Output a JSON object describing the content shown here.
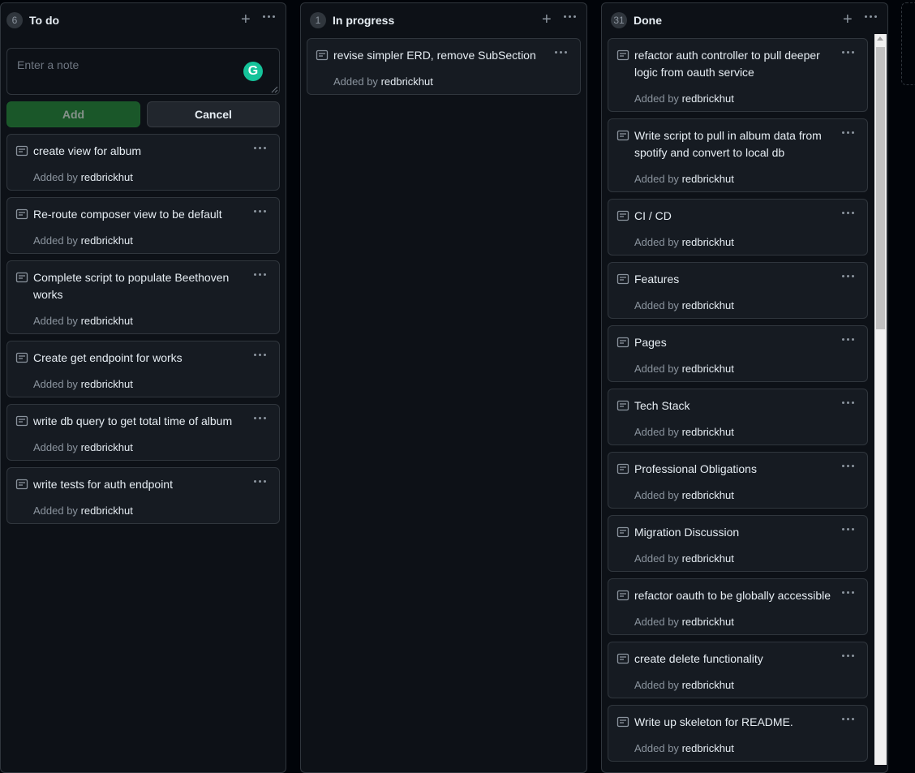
{
  "columns": [
    {
      "title": "To do",
      "count": "6",
      "note_placeholder": "Enter a note",
      "add_label": "Add",
      "cancel_label": "Cancel",
      "cards": [
        {
          "title": "create view for album",
          "added_by": "Added by",
          "author": "redbrickhut"
        },
        {
          "title": "Re-route composer view to be default",
          "added_by": "Added by",
          "author": "redbrickhut"
        },
        {
          "title": "Complete script to populate Beethoven works",
          "added_by": "Added by",
          "author": "redbrickhut"
        },
        {
          "title": "Create get endpoint for works",
          "added_by": "Added by",
          "author": "redbrickhut"
        },
        {
          "title": "write db query to get total time of album",
          "added_by": "Added by",
          "author": "redbrickhut"
        },
        {
          "title": "write tests for auth endpoint",
          "added_by": "Added by",
          "author": "redbrickhut"
        }
      ]
    },
    {
      "title": "In progress",
      "count": "1",
      "cards": [
        {
          "title": "revise simpler ERD, remove SubSection",
          "added_by": "Added by",
          "author": "redbrickhut"
        }
      ]
    },
    {
      "title": "Done",
      "count": "31",
      "cards": [
        {
          "title": "refactor auth controller to pull deeper logic from oauth service",
          "added_by": "Added by",
          "author": "redbrickhut"
        },
        {
          "title": "Write script to pull in album data from spotify and convert to local db",
          "added_by": "Added by",
          "author": "redbrickhut"
        },
        {
          "title": "CI / CD",
          "added_by": "Added by",
          "author": "redbrickhut"
        },
        {
          "title": "Features",
          "added_by": "Added by",
          "author": "redbrickhut"
        },
        {
          "title": "Pages",
          "added_by": "Added by",
          "author": "redbrickhut"
        },
        {
          "title": "Tech Stack",
          "added_by": "Added by",
          "author": "redbrickhut"
        },
        {
          "title": "Professional Obligations",
          "added_by": "Added by",
          "author": "redbrickhut"
        },
        {
          "title": "Migration Discussion",
          "added_by": "Added by",
          "author": "redbrickhut"
        },
        {
          "title": "refactor oauth to be globally accessible",
          "added_by": "Added by",
          "author": "redbrickhut"
        },
        {
          "title": "create delete functionality",
          "added_by": "Added by",
          "author": "redbrickhut"
        },
        {
          "title": "Write up skeleton for README.",
          "added_by": "Added by",
          "author": "redbrickhut"
        }
      ]
    }
  ],
  "icons": {
    "add": "plus-icon",
    "more": "kebab-horizontal-icon",
    "note": "note-icon",
    "grammarly": "grammarly-icon"
  },
  "colors": {
    "background": "#010409",
    "column": "#0d1117",
    "card": "#161b22",
    "border": "#30363d",
    "add_button": "#238636",
    "grammarly": "#15c39a"
  }
}
